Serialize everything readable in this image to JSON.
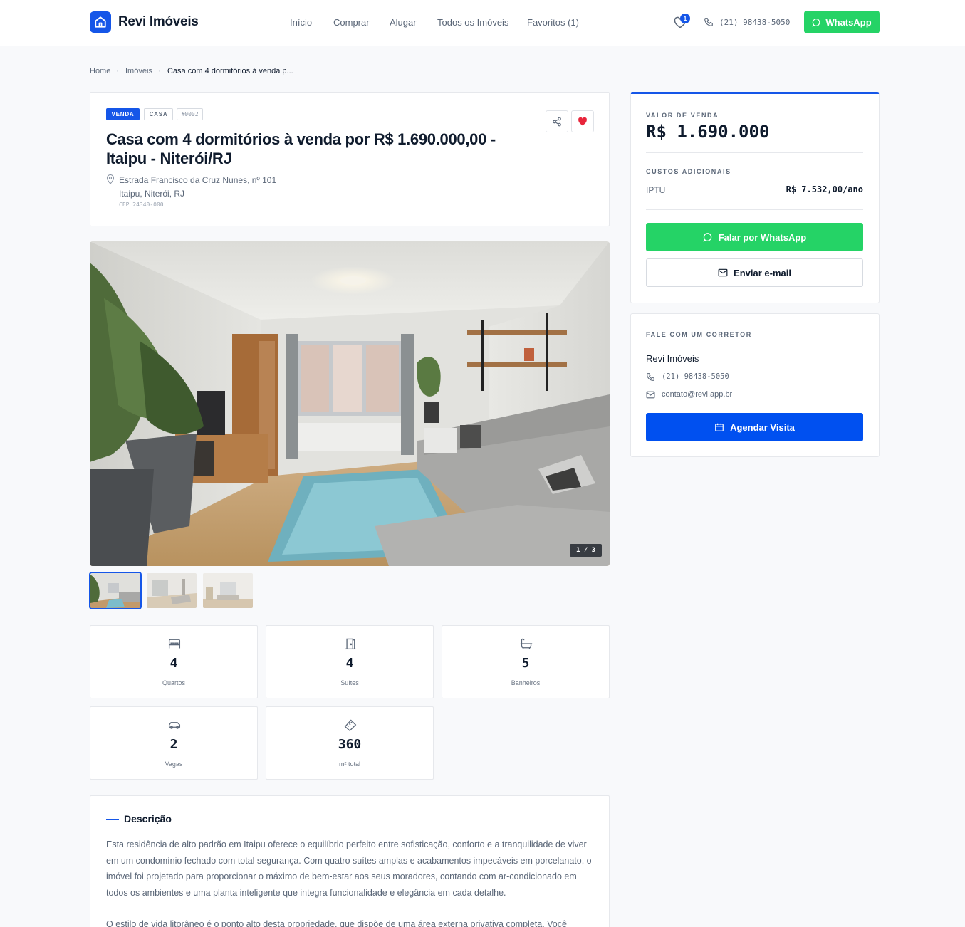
{
  "header": {
    "brand": "Revi Imóveis",
    "nav": [
      "Início",
      "Comprar",
      "Alugar",
      "Todos os Imóveis",
      "Favoritos (1)"
    ],
    "favorites_count": "1",
    "phone": "(21) 98438-5050",
    "whatsapp_label": "WhatsApp"
  },
  "breadcrumb": [
    "Home",
    "Imóveis",
    "Casa com 4 dormitórios à venda p..."
  ],
  "listing": {
    "tags": {
      "deal": "VENDA",
      "type": "CASA",
      "code": "#0002"
    },
    "title": "Casa com 4 dormitórios à venda por R$ 1.690.000,00 - Itaipu - Niterói/RJ",
    "address_line1": "Estrada Francisco da Cruz Nunes, nº 101",
    "address_line2": "Itaipu, Niterói, RJ",
    "cep": "CEP 24340-000",
    "photo_counter": "1 / 3",
    "favorited": true
  },
  "stats": [
    {
      "icon": "bed-icon",
      "value": "4",
      "label": "Quartos"
    },
    {
      "icon": "door-icon",
      "value": "4",
      "label": "Suítes"
    },
    {
      "icon": "bathtub-icon",
      "value": "5",
      "label": "Banheiros"
    },
    {
      "icon": "car-icon",
      "value": "2",
      "label": "Vagas"
    },
    {
      "icon": "ruler-icon",
      "value": "360",
      "label": "m² total"
    }
  ],
  "description": {
    "heading": "Descrição",
    "p1": "Esta residência de alto padrão em Itaipu oferece o equilíbrio perfeito entre sofisticação, conforto e a tranquilidade de viver em um condomínio fechado com total segurança. Com quatro suítes amplas e acabamentos impecáveis em porcelanato, o imóvel foi projetado para proporcionar o máximo de bem-estar aos seus moradores, contando com ar-condicionado em todos os ambientes e uma planta inteligente que integra funcionalidade e elegância em cada detalhe.",
    "p2": "O estilo de vida litorâneo é o ponto alto desta propriedade, que dispõe de uma área externa privativa completa. Você"
  },
  "pricing": {
    "caption": "VALOR DE VENDA",
    "price": "R$ 1.690.000",
    "extra_caption": "CUSTOS ADICIONAIS",
    "iptu_label": "IPTU",
    "iptu_value": "R$ 7.532,00/ano",
    "whatsapp_btn": "Falar por WhatsApp",
    "email_btn": "Enviar e-mail"
  },
  "agent": {
    "caption": "FALE COM UM CORRETOR",
    "name": "Revi Imóveis",
    "phone": "(21) 98438-5050",
    "email": "contato@revi.app.br",
    "visit_btn": "Agendar Visita"
  },
  "colors": {
    "primary": "#1556e8",
    "whatsapp": "#25d366",
    "heart": "#e8253b"
  }
}
